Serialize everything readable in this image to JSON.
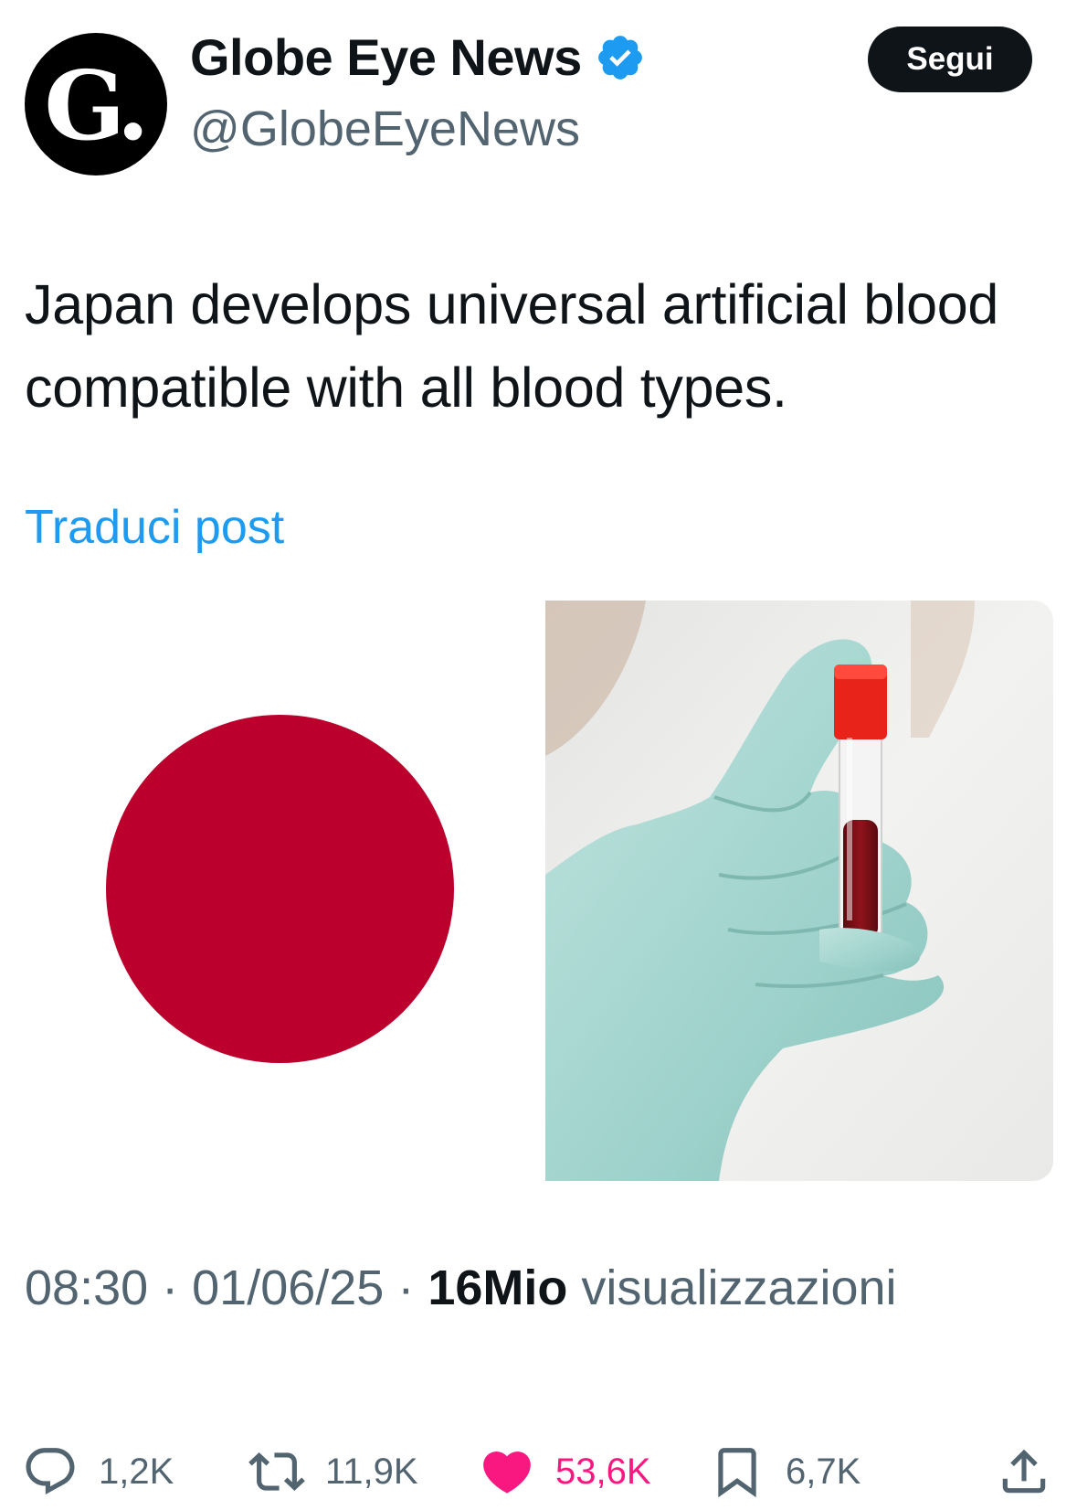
{
  "author": {
    "display_name": "Globe Eye News",
    "handle": "@GlobeEyeNews",
    "avatar_letter": "G.",
    "verified": true
  },
  "follow_button": {
    "label": "Segui"
  },
  "tweet": {
    "text": "Japan develops universal artificial blood compatible with all blood types.",
    "translate_label": "Traduci post"
  },
  "media": [
    {
      "icon": "japan-flag"
    },
    {
      "icon": "gloved-hand-holding-blood-tube"
    }
  ],
  "meta": {
    "time": "08:30",
    "separator": " · ",
    "date": "01/06/25",
    "views_count": "16Mio",
    "views_label": " visualizzazioni"
  },
  "actions": {
    "replies": "1,2K",
    "reposts": "11,9K",
    "likes": "53,6K",
    "bookmarks": "6,7K"
  },
  "colors": {
    "text": "#0f1419",
    "secondary": "#536471",
    "link": "#1d9bf0",
    "like": "#f91880",
    "verified": "#1d9bf0",
    "flag_red": "#bc002d"
  }
}
